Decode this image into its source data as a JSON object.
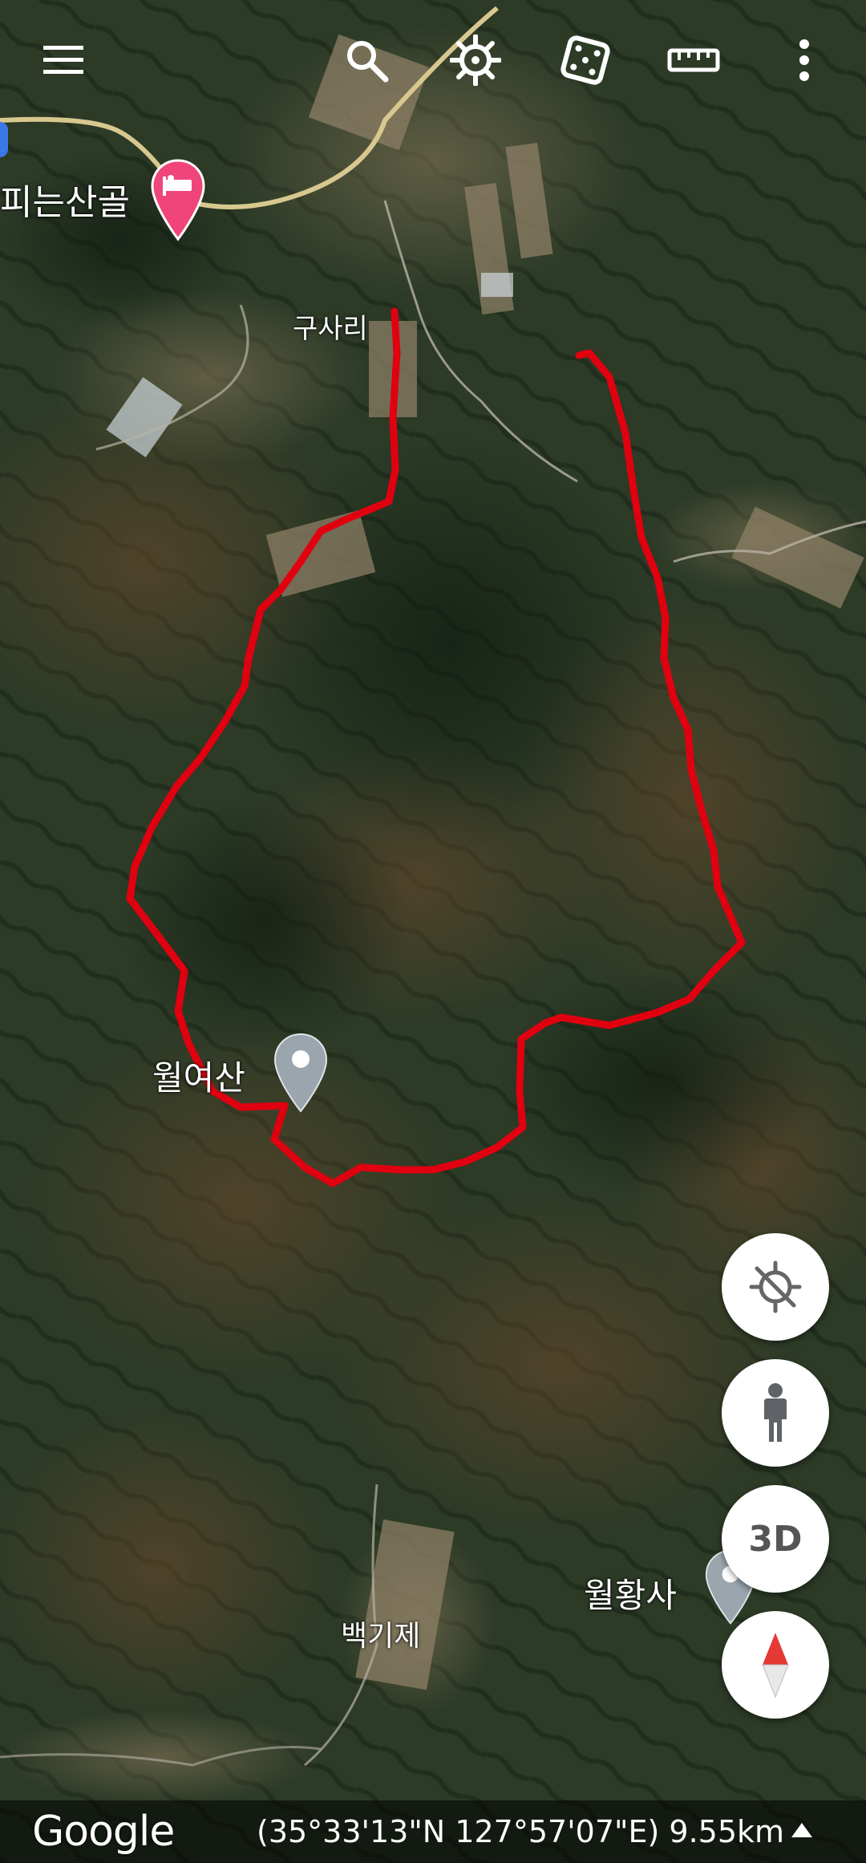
{
  "toolbar": {
    "icons": [
      "menu-icon",
      "search-icon",
      "voyager-icon",
      "feeling-lucky-icon",
      "measure-icon",
      "more-options-icon"
    ]
  },
  "map": {
    "labels": {
      "lodging": "피는산골",
      "village": "구사리",
      "mountain": "월여산",
      "reservoir": "백기제",
      "temple": "월황사"
    },
    "route_color": "#e00010",
    "lodging_pin_color": "#f0457a",
    "place_pin_color": "#9aa5ad"
  },
  "controls": {
    "three_d_label": "3D"
  },
  "footer": {
    "logo": "Google",
    "coordinates": "(35°33'13\"N 127°57'07\"E) 9.55km"
  }
}
